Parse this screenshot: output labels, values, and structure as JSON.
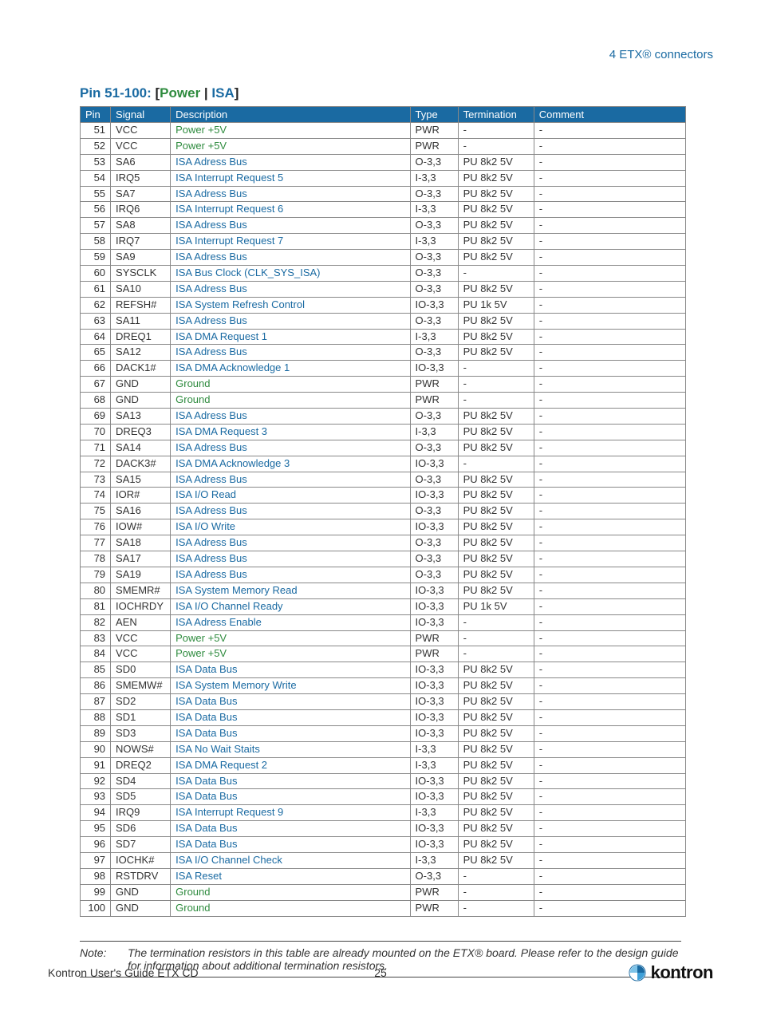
{
  "header": {
    "text": "4 ETX® connectors"
  },
  "section_title": {
    "prefix": "Pin 51-100: ",
    "lbracket": "[",
    "power": "Power",
    "sep": " | ",
    "isa": "ISA",
    "rbracket": "]"
  },
  "columns": [
    "Pin",
    "Signal",
    "Description",
    "Type",
    "Termination",
    "Comment"
  ],
  "rows": [
    {
      "pin": "51",
      "signal": "VCC",
      "desc": "Power +5V",
      "type": "PWR",
      "term": "-",
      "comment": "-",
      "cat": "pwr"
    },
    {
      "pin": "52",
      "signal": "VCC",
      "desc": "Power +5V",
      "type": "PWR",
      "term": "-",
      "comment": "-",
      "cat": "pwr"
    },
    {
      "pin": "53",
      "signal": "SA6",
      "desc": "ISA Adress Bus",
      "type": "O-3,3",
      "term": "PU 8k2 5V",
      "comment": "-",
      "cat": "isa"
    },
    {
      "pin": "54",
      "signal": "IRQ5",
      "desc": "ISA Interrupt Request 5",
      "type": "I-3,3",
      "term": "PU 8k2 5V",
      "comment": "-",
      "cat": "isa"
    },
    {
      "pin": "55",
      "signal": "SA7",
      "desc": "ISA Adress Bus",
      "type": "O-3,3",
      "term": "PU 8k2 5V",
      "comment": "-",
      "cat": "isa"
    },
    {
      "pin": "56",
      "signal": "IRQ6",
      "desc": "ISA Interrupt Request 6",
      "type": "I-3,3",
      "term": "PU 8k2 5V",
      "comment": "-",
      "cat": "isa"
    },
    {
      "pin": "57",
      "signal": "SA8",
      "desc": "ISA Adress Bus",
      "type": "O-3,3",
      "term": "PU 8k2 5V",
      "comment": "-",
      "cat": "isa"
    },
    {
      "pin": "58",
      "signal": "IRQ7",
      "desc": "ISA Interrupt Request 7",
      "type": "I-3,3",
      "term": "PU 8k2 5V",
      "comment": "-",
      "cat": "isa"
    },
    {
      "pin": "59",
      "signal": "SA9",
      "desc": "ISA Adress Bus",
      "type": "O-3,3",
      "term": "PU 8k2 5V",
      "comment": "-",
      "cat": "isa"
    },
    {
      "pin": "60",
      "signal": "SYSCLK",
      "desc": "ISA Bus Clock (CLK_SYS_ISA)",
      "type": "O-3,3",
      "term": "-",
      "comment": "-",
      "cat": "isa"
    },
    {
      "pin": "61",
      "signal": "SA10",
      "desc": "ISA Adress Bus",
      "type": "O-3,3",
      "term": "PU 8k2 5V",
      "comment": "-",
      "cat": "isa"
    },
    {
      "pin": "62",
      "signal": "REFSH#",
      "desc": "ISA System Refresh Control",
      "type": "IO-3,3",
      "term": "PU 1k 5V",
      "comment": "-",
      "cat": "isa"
    },
    {
      "pin": "63",
      "signal": "SA11",
      "desc": "ISA Adress Bus",
      "type": "O-3,3",
      "term": "PU 8k2 5V",
      "comment": "-",
      "cat": "isa"
    },
    {
      "pin": "64",
      "signal": "DREQ1",
      "desc": "ISA DMA Request 1",
      "type": "I-3,3",
      "term": "PU 8k2 5V",
      "comment": "-",
      "cat": "isa"
    },
    {
      "pin": "65",
      "signal": "SA12",
      "desc": "ISA Adress Bus",
      "type": "O-3,3",
      "term": "PU 8k2 5V",
      "comment": "-",
      "cat": "isa"
    },
    {
      "pin": "66",
      "signal": "DACK1#",
      "desc": "ISA DMA Acknowledge 1",
      "type": "IO-3,3",
      "term": "-",
      "comment": "-",
      "cat": "isa"
    },
    {
      "pin": "67",
      "signal": "GND",
      "desc": "Ground",
      "type": "PWR",
      "term": "-",
      "comment": "-",
      "cat": "pwr"
    },
    {
      "pin": "68",
      "signal": "GND",
      "desc": "Ground",
      "type": "PWR",
      "term": "-",
      "comment": "-",
      "cat": "pwr"
    },
    {
      "pin": "69",
      "signal": "SA13",
      "desc": "ISA Adress Bus",
      "type": "O-3,3",
      "term": "PU 8k2 5V",
      "comment": "-",
      "cat": "isa"
    },
    {
      "pin": "70",
      "signal": "DREQ3",
      "desc": "ISA DMA Request 3",
      "type": "I-3,3",
      "term": "PU 8k2 5V",
      "comment": "-",
      "cat": "isa"
    },
    {
      "pin": "71",
      "signal": "SA14",
      "desc": "ISA Adress Bus",
      "type": "O-3,3",
      "term": "PU 8k2 5V",
      "comment": "-",
      "cat": "isa"
    },
    {
      "pin": "72",
      "signal": "DACK3#",
      "desc": "ISA DMA Acknowledge 3",
      "type": "IO-3,3",
      "term": "-",
      "comment": "-",
      "cat": "isa"
    },
    {
      "pin": "73",
      "signal": "SA15",
      "desc": "ISA Adress Bus",
      "type": "O-3,3",
      "term": "PU 8k2 5V",
      "comment": "-",
      "cat": "isa"
    },
    {
      "pin": "74",
      "signal": "IOR#",
      "desc": "ISA I/O Read",
      "type": "IO-3,3",
      "term": "PU 8k2 5V",
      "comment": "-",
      "cat": "isa"
    },
    {
      "pin": "75",
      "signal": "SA16",
      "desc": "ISA Adress Bus",
      "type": "O-3,3",
      "term": "PU 8k2 5V",
      "comment": "-",
      "cat": "isa"
    },
    {
      "pin": "76",
      "signal": "IOW#",
      "desc": "ISA I/O Write",
      "type": "IO-3,3",
      "term": "PU 8k2 5V",
      "comment": "-",
      "cat": "isa"
    },
    {
      "pin": "77",
      "signal": "SA18",
      "desc": "ISA Adress Bus",
      "type": "O-3,3",
      "term": "PU 8k2 5V",
      "comment": "-",
      "cat": "isa"
    },
    {
      "pin": "78",
      "signal": "SA17",
      "desc": "ISA Adress Bus",
      "type": "O-3,3",
      "term": "PU 8k2 5V",
      "comment": "-",
      "cat": "isa"
    },
    {
      "pin": "79",
      "signal": "SA19",
      "desc": "ISA Adress Bus",
      "type": "O-3,3",
      "term": "PU 8k2 5V",
      "comment": "-",
      "cat": "isa"
    },
    {
      "pin": "80",
      "signal": "SMEMR#",
      "desc": "ISA System Memory Read",
      "type": "IO-3,3",
      "term": "PU 8k2 5V",
      "comment": "-",
      "cat": "isa"
    },
    {
      "pin": "81",
      "signal": "IOCHRDY",
      "desc": "ISA I/O Channel Ready",
      "type": "IO-3,3",
      "term": "PU 1k 5V",
      "comment": "-",
      "cat": "isa"
    },
    {
      "pin": "82",
      "signal": "AEN",
      "desc": "ISA Adress Enable",
      "type": "IO-3,3",
      "term": "-",
      "comment": "-",
      "cat": "isa"
    },
    {
      "pin": "83",
      "signal": "VCC",
      "desc": "Power +5V",
      "type": "PWR",
      "term": "-",
      "comment": "-",
      "cat": "pwr"
    },
    {
      "pin": "84",
      "signal": "VCC",
      "desc": "Power +5V",
      "type": "PWR",
      "term": "-",
      "comment": "-",
      "cat": "pwr"
    },
    {
      "pin": "85",
      "signal": "SD0",
      "desc": "ISA Data Bus",
      "type": "IO-3,3",
      "term": "PU 8k2 5V",
      "comment": "-",
      "cat": "isa"
    },
    {
      "pin": "86",
      "signal": "SMEMW#",
      "desc": "ISA System Memory Write",
      "type": "IO-3,3",
      "term": "PU 8k2 5V",
      "comment": "-",
      "cat": "isa"
    },
    {
      "pin": "87",
      "signal": "SD2",
      "desc": "ISA Data Bus",
      "type": "IO-3,3",
      "term": "PU 8k2 5V",
      "comment": "-",
      "cat": "isa"
    },
    {
      "pin": "88",
      "signal": "SD1",
      "desc": "ISA Data Bus",
      "type": "IO-3,3",
      "term": "PU 8k2 5V",
      "comment": "-",
      "cat": "isa"
    },
    {
      "pin": "89",
      "signal": "SD3",
      "desc": "ISA Data Bus",
      "type": "IO-3,3",
      "term": "PU 8k2 5V",
      "comment": "-",
      "cat": "isa"
    },
    {
      "pin": "90",
      "signal": "NOWS#",
      "desc": "ISA No Wait Staits",
      "type": "I-3,3",
      "term": "PU 8k2 5V",
      "comment": "-",
      "cat": "isa"
    },
    {
      "pin": "91",
      "signal": "DREQ2",
      "desc": "ISA DMA Request 2",
      "type": "I-3,3",
      "term": "PU 8k2 5V",
      "comment": "-",
      "cat": "isa"
    },
    {
      "pin": "92",
      "signal": "SD4",
      "desc": "ISA Data Bus",
      "type": "IO-3,3",
      "term": "PU 8k2 5V",
      "comment": "-",
      "cat": "isa"
    },
    {
      "pin": "93",
      "signal": "SD5",
      "desc": "ISA Data Bus",
      "type": "IO-3,3",
      "term": "PU 8k2 5V",
      "comment": "-",
      "cat": "isa"
    },
    {
      "pin": "94",
      "signal": "IRQ9",
      "desc": "ISA Interrupt Request 9",
      "type": "I-3,3",
      "term": "PU 8k2 5V",
      "comment": "-",
      "cat": "isa"
    },
    {
      "pin": "95",
      "signal": "SD6",
      "desc": "ISA Data Bus",
      "type": "IO-3,3",
      "term": "PU 8k2 5V",
      "comment": "-",
      "cat": "isa"
    },
    {
      "pin": "96",
      "signal": "SD7",
      "desc": "ISA Data Bus",
      "type": "IO-3,3",
      "term": "PU 8k2 5V",
      "comment": "-",
      "cat": "isa"
    },
    {
      "pin": "97",
      "signal": "IOCHK#",
      "desc": "ISA I/O Channel Check",
      "type": "I-3,3",
      "term": "PU 8k2 5V",
      "comment": "-",
      "cat": "isa"
    },
    {
      "pin": "98",
      "signal": "RSTDRV",
      "desc": "ISA Reset",
      "type": "O-3,3",
      "term": "-",
      "comment": "-",
      "cat": "isa"
    },
    {
      "pin": "99",
      "signal": "GND",
      "desc": "Ground",
      "type": "PWR",
      "term": "-",
      "comment": "-",
      "cat": "pwr"
    },
    {
      "pin": "100",
      "signal": "GND",
      "desc": "Ground",
      "type": "PWR",
      "term": "-",
      "comment": "-",
      "cat": "pwr"
    }
  ],
  "note": {
    "label": "Note:",
    "text": "The termination resistors in this table are already mounted on the ETX® board. Please refer to the design guide for information about additional termination resistors."
  },
  "footer": {
    "left": "Kontron User's Guide ETX CD",
    "page": "25",
    "logo_text": "kontron"
  }
}
